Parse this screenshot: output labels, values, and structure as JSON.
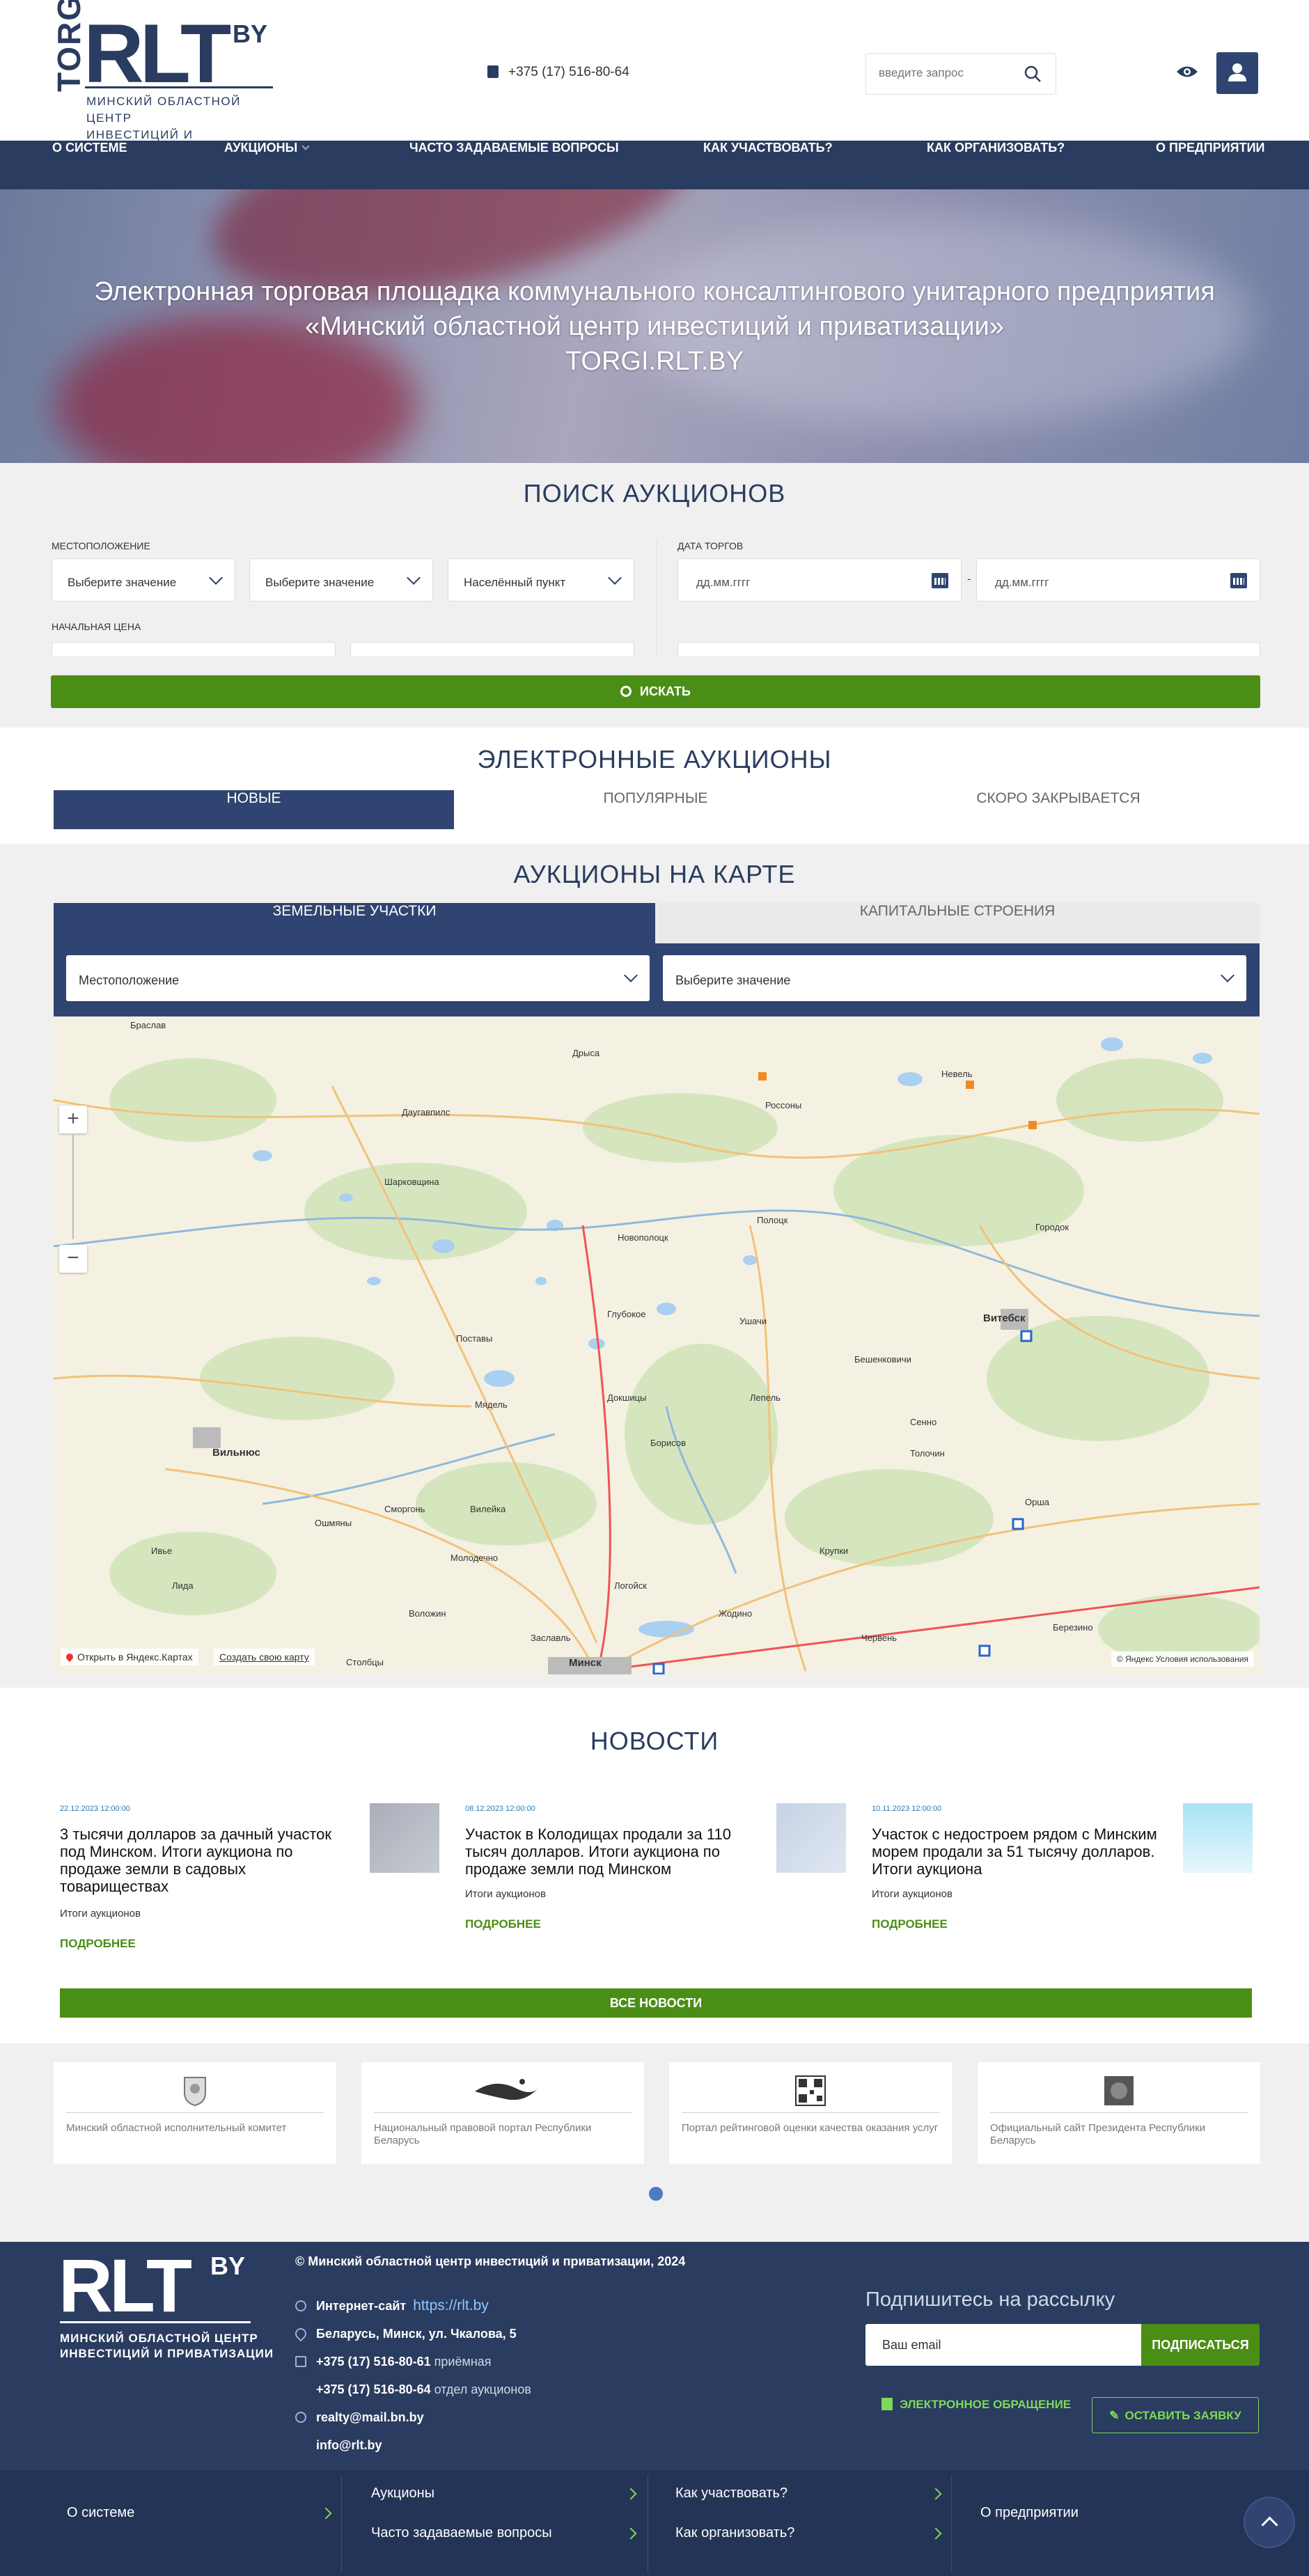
{
  "header": {
    "logo_torgi": "TORGI",
    "logo_rlt": "RLT",
    "logo_by": "BY",
    "logo_sub_line1": "Минский областной центр",
    "logo_sub_line2": "инвестиций и приватизации",
    "phone": "+375 (17) 516-80-64",
    "search_placeholder": "введите запрос"
  },
  "nav": {
    "items": [
      "О системе",
      "Аукционы",
      "Часто задаваемые вопросы",
      "Как участвовать?",
      "Как организовать?",
      "О предприятии"
    ]
  },
  "hero": {
    "line1": "Электронная торговая площадка коммунального консалтингового унитарного предприятия",
    "line2": "«Минский областной центр инвестиций и приватизации»",
    "line3": "TORGI.RLT.BY"
  },
  "search": {
    "title": "Поиск аукционов",
    "location_label": "Местоположение",
    "select1": "Выберите значение",
    "select2": "Выберите значение",
    "select3": "Населённый пункт",
    "date_label": "Дата торгов",
    "date_from": "дд.мм.гггг",
    "date_sep": "-",
    "date_to": "дд.мм.гггг",
    "price_label": "Начальная цена",
    "button": "Искать"
  },
  "e_auctions": {
    "title": "Электронные аукционы",
    "tabs": [
      "Новые",
      "Популярные",
      "Скоро закрывается"
    ]
  },
  "map_section": {
    "title": "Аукционы на карте",
    "tabs": [
      "Земельные участки",
      "Капитальные строения"
    ],
    "select_location": "Местоположение",
    "select_value": "Выберите значение",
    "open_yandex": "Открыть в Яндекс.Картах",
    "create_map": "Создать свою карту",
    "copyright": "© Яндекс Условия использования",
    "cities": [
      "Браслав",
      "Даугавпилс",
      "Дрыса",
      "Россоны",
      "Невель",
      "Полоцк",
      "Новополоцк",
      "Глубокое",
      "Витебск",
      "Лепель",
      "Докшицы",
      "Городок",
      "Шарковщина",
      "Поставы",
      "Мядель",
      "Вилейка",
      "Молодечно",
      "Сморгонь",
      "Ошмяны",
      "Вильнюс",
      "Минск",
      "Борисов",
      "Крупки",
      "Толочин",
      "Орша",
      "Сенно",
      "Бешенковичи",
      "Ушачи",
      "Логойск",
      "Заславль",
      "Жодино",
      "Червень",
      "Березино",
      "Молодечно",
      "Лида",
      "Ивье",
      "Воложин",
      "Столбцы"
    ]
  },
  "news": {
    "title": "Новости",
    "items": [
      {
        "date": "22.12.2023 12:00:00",
        "title": "3 тысячи долларов за дачный участок под Минском. Итоги аукциона по продаже земли в садовых товариществах",
        "category": "Итоги аукционов",
        "more": "Подробнее"
      },
      {
        "date": "08.12.2023 12:00:00",
        "title": "Участок в Колодищах продали за 110 тысяч долларов. Итоги аукциона по продаже земли под Минском",
        "category": "Итоги аукционов",
        "more": "Подробнее"
      },
      {
        "date": "10.11.2023 12:00:00",
        "title": "Участок с недостроем рядом с Минским морем продали за 51 тысячу долларов. Итоги аукциона",
        "category": "Итоги аукционов",
        "more": "Подробнее"
      }
    ],
    "all_button": "Все новости"
  },
  "partners": [
    {
      "name": "Минский областной исполнительный комитет"
    },
    {
      "name": "Национальный правовой портал Республики Беларусь"
    },
    {
      "name": "Портал рейтинговой оценки качества оказания услуг"
    },
    {
      "name": "Официальный сайт Президента Республики Беларусь"
    }
  ],
  "footer": {
    "logo_rlt": "RLT",
    "logo_by": "BY",
    "logo_sub_line1": "Минский областной центр",
    "logo_sub_line2": "инвестиций и приватизации",
    "copyright": "© Минский областной центр инвестиций и приватизации, 2024",
    "site_label": "Интернет-сайт",
    "site_url": "https://rlt.by",
    "address": "Беларусь, Минск, ул. Чкалова, 5",
    "phone1": "+375 (17) 516-80-61",
    "phone1_note": "приёмная",
    "phone2": "+375 (17) 516-80-64",
    "phone2_note": "отдел аукционов",
    "email1": "realty@mail.bn.by",
    "email2": "info@rlt.by",
    "subscribe_title": "Подпишитесь на рассылку",
    "email_placeholder": "Ваш email",
    "subscribe_button": "Подписаться",
    "appeal": "Электронное обращение",
    "request": "Оставить заявку",
    "nav": [
      "О системе",
      "Аукционы",
      "Часто задаваемые вопросы",
      "Как участвовать?",
      "Как организовать?",
      "О предприятии"
    ]
  },
  "colors": {
    "brand": "#2a3c5f",
    "accent_green": "#4b8e16",
    "section_bg": "#f0f0f0"
  }
}
